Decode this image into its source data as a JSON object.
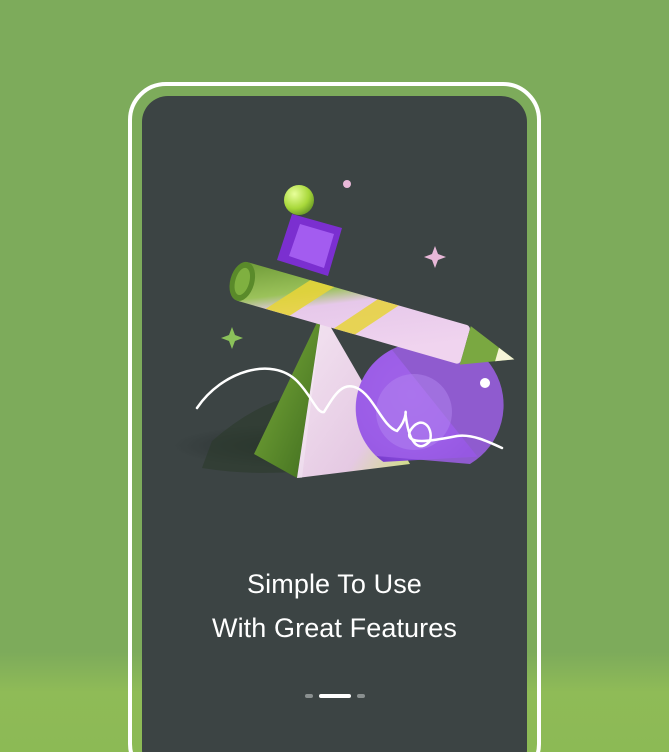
{
  "onboarding": {
    "headline_line1": "Simple To Use",
    "headline_line2": "With Great Features"
  },
  "pager": {
    "total_pages": 3,
    "active_index": 1
  },
  "colors": {
    "background": "#7dab5b",
    "screen": "#3c4444",
    "accent_purple": "#8b3fd6",
    "accent_green": "#5f8f2e",
    "pink": "#e8c6e6",
    "lime": "#c4e84a",
    "yellow": "#e6d43a"
  },
  "icons": [
    "sphere-icon",
    "cube-icon",
    "pencil-icon",
    "pyramid-icon",
    "half-disc-icon",
    "sparkle-icon"
  ]
}
